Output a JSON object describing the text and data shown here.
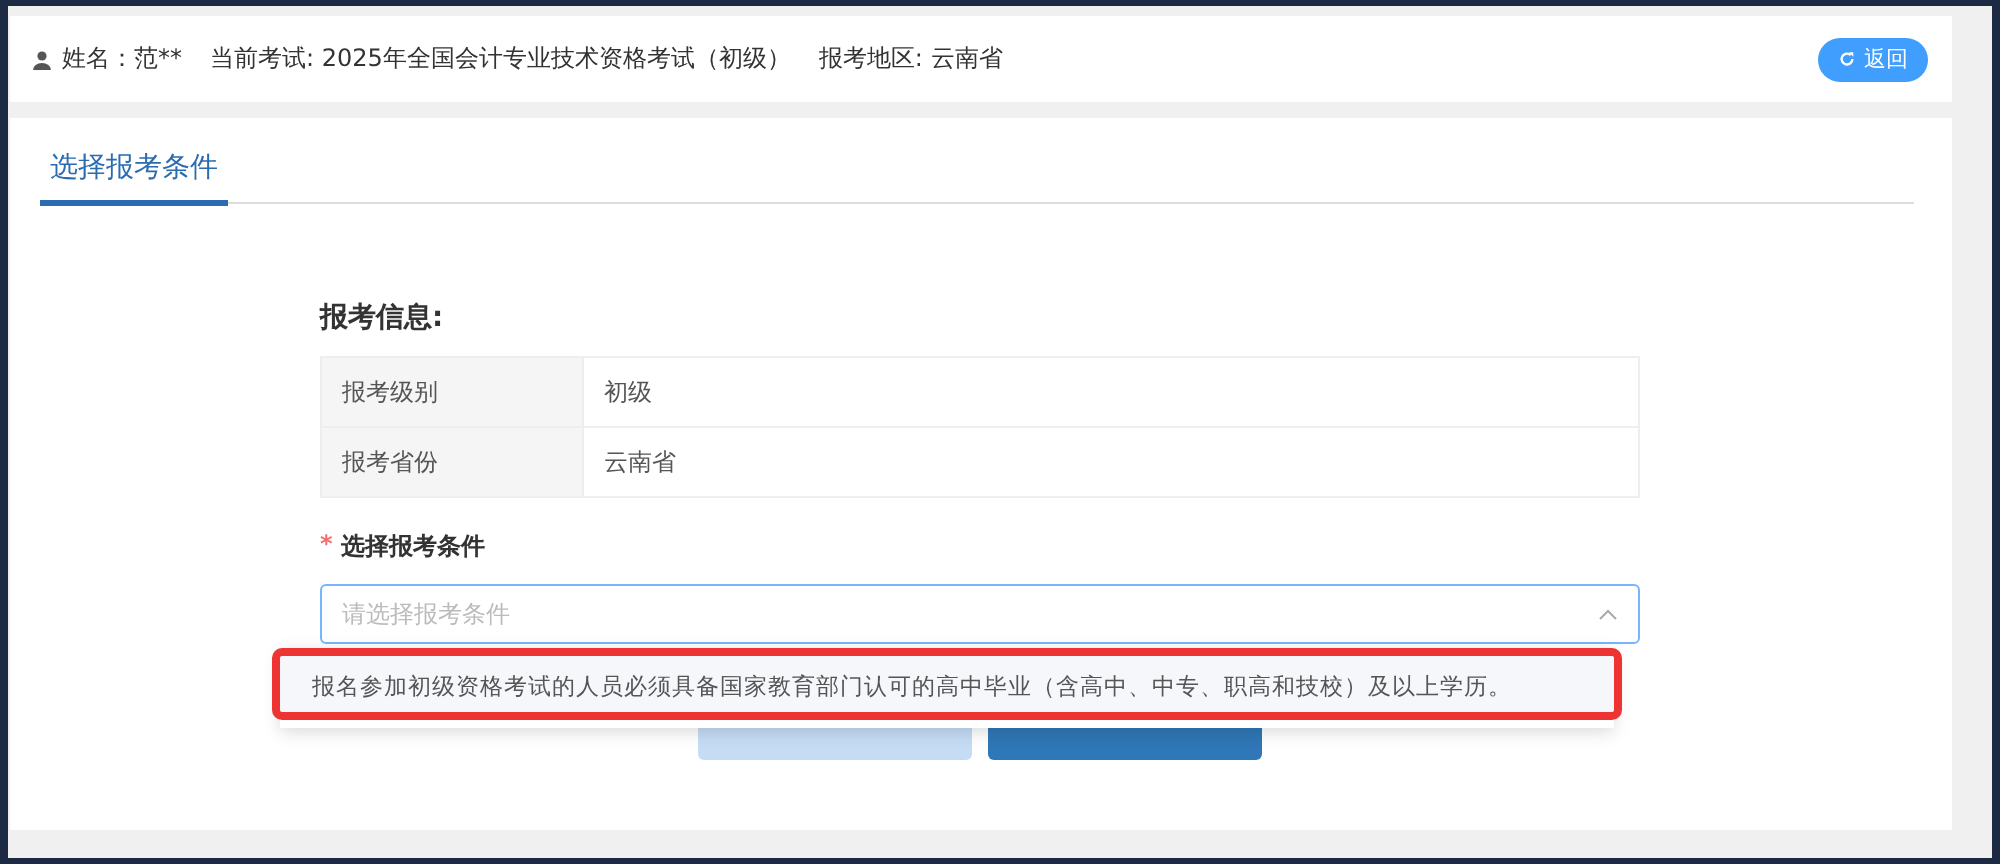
{
  "header": {
    "items": [
      "姓名：范**",
      "当前考试: 2025年全国会计专业技术资格考试（初级）",
      "报考地区: 云南省"
    ],
    "back_button": "返回"
  },
  "tabs": [
    {
      "label": "选择报考条件",
      "selected": true
    }
  ],
  "info": {
    "title": "报考信息:",
    "rows": [
      {
        "label": "报考级别",
        "value": "初级"
      },
      {
        "label": "报考省份",
        "value": "云南省"
      }
    ]
  },
  "condition": {
    "label": "选择报考条件",
    "required_mark": "*",
    "placeholder": "请选择报考条件",
    "expanded": true,
    "options": [
      {
        "text": "报名参加初级资格考试的人员必须具备国家教育部门认可的高中毕业（含高中、中专、职高和技校）及以上学历。",
        "highlighted": true
      }
    ]
  },
  "buttons": [
    {
      "kind": "secondary"
    },
    {
      "kind": "primary"
    }
  ]
}
